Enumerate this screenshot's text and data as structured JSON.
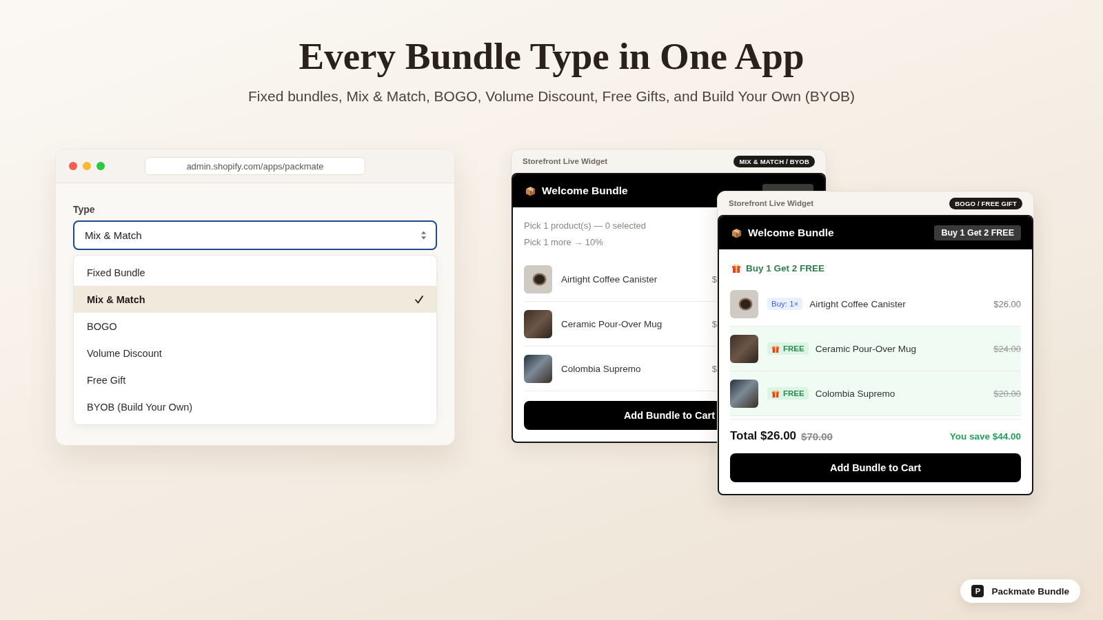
{
  "heading": {
    "title": "Every Bundle Type in One App",
    "subtitle": "Fixed bundles, Mix & Match, BOGO, Volume Discount, Free Gifts, and Build Your Own (BYOB)"
  },
  "admin_window": {
    "url": "admin.shopify.com/apps/packmate",
    "field": {
      "label": "Type",
      "value": "Mix & Match"
    },
    "options": [
      {
        "label": "Fixed Bundle",
        "selected": false
      },
      {
        "label": "Mix & Match",
        "selected": true
      },
      {
        "label": "BOGO",
        "selected": false
      },
      {
        "label": "Volume Discount",
        "selected": false
      },
      {
        "label": "Free Gift",
        "selected": false
      },
      {
        "label": "BYOB (Build Your Own)",
        "selected": false
      }
    ]
  },
  "widgets": [
    {
      "kind": "mix_match",
      "caption": "Storefront Live Widget",
      "badge": "MIX & MATCH / BYOB",
      "title": "Welcome Bundle",
      "notes": [
        "Pick 1 product(s) — 0 selected",
        "Pick 1 more → 10%"
      ],
      "products": [
        {
          "kind": "pick",
          "name": "Airtight Coffee Canister",
          "price": "$",
          "price_struck": false
        },
        {
          "kind": "pick",
          "name": "Ceramic Pour-Over Mug",
          "price": "$",
          "price_struck": false
        },
        {
          "kind": "pick",
          "name": "Colombia Supremo",
          "price": "$",
          "price_struck": false
        }
      ],
      "button": "Add Bundle to Cart"
    },
    {
      "kind": "bogo",
      "caption": "Storefront Live Widget",
      "badge": "BOGO / FREE GIFT",
      "title": "Welcome Bundle",
      "header_tag": "Buy 1 Get 2 FREE",
      "offer": "Buy 1 Get 2 FREE",
      "products": [
        {
          "kind": "buy",
          "tag": "Buy: 1×",
          "name": "Airtight Coffee Canister",
          "price": "$26.00",
          "price_struck": false
        },
        {
          "kind": "free",
          "tag": "FREE",
          "name": "Ceramic Pour-Over Mug",
          "price": "$24.00",
          "price_struck": true
        },
        {
          "kind": "free",
          "tag": "FREE",
          "name": "Colombia Supremo",
          "price": "$20.00",
          "price_struck": true
        }
      ],
      "total": {
        "amount": "Total $26.00",
        "original": "$70.00",
        "savings": "You save $44.00"
      },
      "button": "Add Bundle to Cart"
    }
  ],
  "brand_badge": {
    "logo": "P",
    "label": "Packmate Bundle"
  }
}
